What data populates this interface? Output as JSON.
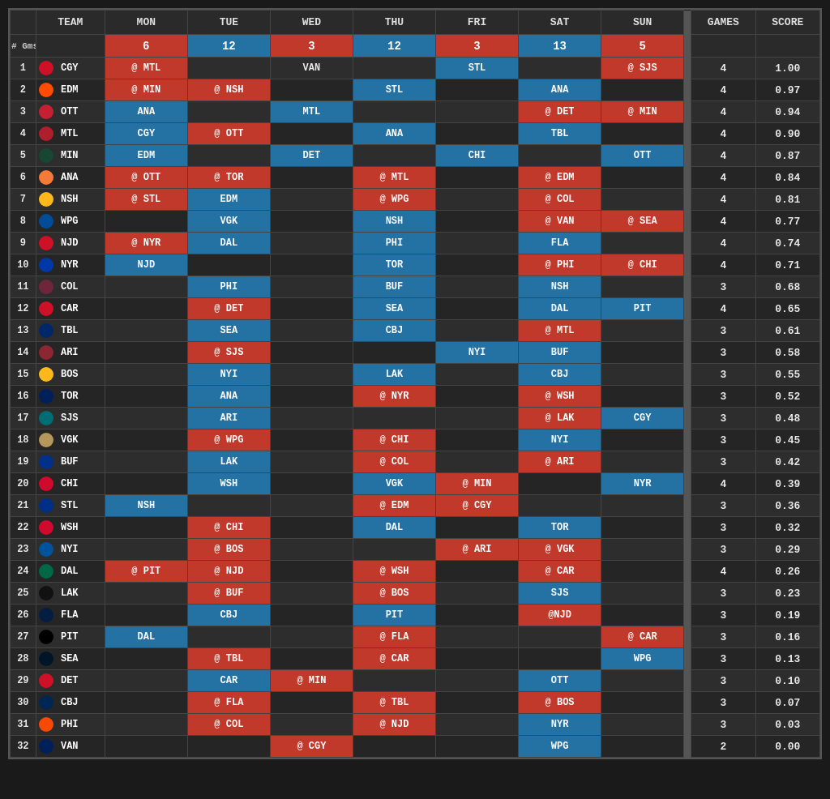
{
  "header": {
    "col1": "#",
    "col2": "TEAM",
    "days": [
      "MON",
      "TUE",
      "WED",
      "THU",
      "FRI",
      "SAT",
      "SUN"
    ],
    "games": "GAMES",
    "score": "SCORE",
    "gms_label": "# Gms",
    "day_counts": [
      "6",
      "12",
      "3",
      "12",
      "3",
      "13",
      "5"
    ]
  },
  "teams": [
    {
      "rank": 1,
      "abbr": "CGY",
      "icon": "CGY",
      "mon": "@ MTL",
      "tue": "",
      "wed": "VAN",
      "thu": "",
      "fri": "STL",
      "sat": "",
      "sun": "@ SJS",
      "games": 4,
      "score": "1.00",
      "mon_c": "red",
      "fri_c": "blue",
      "sun_c": "red"
    },
    {
      "rank": 2,
      "abbr": "EDM",
      "icon": "EDM",
      "mon": "@ MIN",
      "tue": "@ NSH",
      "wed": "",
      "thu": "STL",
      "fri": "",
      "sat": "ANA",
      "sun": "",
      "games": 4,
      "score": "0.97",
      "mon_c": "red",
      "tue_c": "red",
      "thu_c": "blue",
      "sat_c": "blue"
    },
    {
      "rank": 3,
      "abbr": "OTT",
      "icon": "OTT",
      "mon": "ANA",
      "tue": "",
      "wed": "MTL",
      "thu": "",
      "fri": "",
      "sat": "@ DET",
      "sun": "@ MIN",
      "games": 4,
      "score": "0.94",
      "mon_c": "blue",
      "wed_c": "blue",
      "sat_c": "red",
      "sun_c": "red"
    },
    {
      "rank": 4,
      "abbr": "MTL",
      "icon": "MTL",
      "mon": "CGY",
      "tue": "@ OTT",
      "wed": "",
      "thu": "ANA",
      "fri": "",
      "sat": "TBL",
      "sun": "",
      "games": 4,
      "score": "0.90",
      "mon_c": "blue",
      "tue_c": "red",
      "thu_c": "blue",
      "sat_c": "blue"
    },
    {
      "rank": 5,
      "abbr": "MIN",
      "icon": "MIN",
      "mon": "EDM",
      "tue": "",
      "wed": "DET",
      "thu": "",
      "fri": "CHI",
      "sat": "",
      "sun": "OTT",
      "games": 4,
      "score": "0.87",
      "mon_c": "blue",
      "wed_c": "blue",
      "fri_c": "blue",
      "sun_c": "blue"
    },
    {
      "rank": 6,
      "abbr": "ANA",
      "icon": "ANA",
      "mon": "@ OTT",
      "tue": "@ TOR",
      "wed": "",
      "thu": "@ MTL",
      "fri": "",
      "sat": "@ EDM",
      "sun": "",
      "games": 4,
      "score": "0.84",
      "mon_c": "red",
      "tue_c": "red",
      "thu_c": "red",
      "sat_c": "red"
    },
    {
      "rank": 7,
      "abbr": "NSH",
      "icon": "NSH",
      "mon": "@ STL",
      "tue": "EDM",
      "wed": "",
      "thu": "@ WPG",
      "fri": "",
      "sat": "@ COL",
      "sun": "",
      "games": 4,
      "score": "0.81",
      "mon_c": "red",
      "tue_c": "blue",
      "thu_c": "red",
      "sat_c": "red"
    },
    {
      "rank": 8,
      "abbr": "WPG",
      "icon": "WPG",
      "mon": "",
      "tue": "VGK",
      "wed": "",
      "thu": "NSH",
      "fri": "",
      "sat": "@ VAN",
      "sun": "@ SEA",
      "games": 4,
      "score": "0.77",
      "tue_c": "blue",
      "thu_c": "blue",
      "sat_c": "red",
      "sun_c": "red"
    },
    {
      "rank": 9,
      "abbr": "NJD",
      "icon": "NJD",
      "mon": "@ NYR",
      "tue": "DAL",
      "wed": "",
      "thu": "PHI",
      "fri": "",
      "sat": "FLA",
      "sun": "",
      "games": 4,
      "score": "0.74",
      "mon_c": "red",
      "tue_c": "blue",
      "thu_c": "blue",
      "sat_c": "blue"
    },
    {
      "rank": 10,
      "abbr": "NYR",
      "icon": "NYR",
      "mon": "NJD",
      "tue": "",
      "wed": "",
      "thu": "TOR",
      "fri": "",
      "sat": "@ PHI",
      "sun": "@ CHI",
      "games": 4,
      "score": "0.71",
      "mon_c": "blue",
      "thu_c": "blue",
      "sat_c": "red",
      "sun_c": "red"
    },
    {
      "rank": 11,
      "abbr": "COL",
      "icon": "COL",
      "mon": "",
      "tue": "PHI",
      "wed": "",
      "thu": "BUF",
      "fri": "",
      "sat": "NSH",
      "sun": "",
      "games": 3,
      "score": "0.68",
      "tue_c": "blue",
      "thu_c": "blue",
      "sat_c": "blue"
    },
    {
      "rank": 12,
      "abbr": "CAR",
      "icon": "CAR",
      "mon": "",
      "tue": "@ DET",
      "wed": "",
      "thu": "SEA",
      "fri": "",
      "sat": "DAL",
      "sun": "PIT",
      "games": 4,
      "score": "0.65",
      "tue_c": "red",
      "thu_c": "blue",
      "sat_c": "blue",
      "sun_c": "blue"
    },
    {
      "rank": 13,
      "abbr": "TBL",
      "icon": "TBL",
      "mon": "",
      "tue": "SEA",
      "wed": "",
      "thu": "CBJ",
      "fri": "",
      "sat": "@ MTL",
      "sun": "",
      "games": 3,
      "score": "0.61",
      "tue_c": "blue",
      "thu_c": "blue",
      "sat_c": "red"
    },
    {
      "rank": 14,
      "abbr": "ARI",
      "icon": "ARI",
      "mon": "",
      "tue": "@ SJS",
      "wed": "",
      "thu": "",
      "fri": "NYI",
      "sat": "BUF",
      "sun": "",
      "games": 3,
      "score": "0.58",
      "tue_c": "red",
      "fri_c": "blue",
      "sat_c": "blue"
    },
    {
      "rank": 15,
      "abbr": "BOS",
      "icon": "BOS",
      "mon": "",
      "tue": "NYI",
      "wed": "",
      "thu": "LAK",
      "fri": "",
      "sat": "CBJ",
      "sun": "",
      "games": 3,
      "score": "0.55",
      "tue_c": "blue",
      "thu_c": "blue",
      "sat_c": "blue"
    },
    {
      "rank": 16,
      "abbr": "TOR",
      "icon": "TOR",
      "mon": "",
      "tue": "ANA",
      "wed": "",
      "thu": "@ NYR",
      "fri": "",
      "sat": "@ WSH",
      "sun": "",
      "games": 3,
      "score": "0.52",
      "tue_c": "blue",
      "thu_c": "red",
      "sat_c": "red"
    },
    {
      "rank": 17,
      "abbr": "SJS",
      "icon": "SJS",
      "mon": "",
      "tue": "ARI",
      "wed": "",
      "thu": "",
      "fri": "",
      "sat": "@ LAK",
      "sun": "CGY",
      "games": 3,
      "score": "0.48",
      "tue_c": "blue",
      "sat_c": "red",
      "sun_c": "blue"
    },
    {
      "rank": 18,
      "abbr": "VGK",
      "icon": "VGK",
      "mon": "",
      "tue": "@ WPG",
      "wed": "",
      "thu": "@ CHI",
      "fri": "",
      "sat": "NYI",
      "sun": "",
      "games": 3,
      "score": "0.45",
      "tue_c": "red",
      "thu_c": "red",
      "sat_c": "blue"
    },
    {
      "rank": 19,
      "abbr": "BUF",
      "icon": "BUF",
      "mon": "",
      "tue": "LAK",
      "wed": "",
      "thu": "@ COL",
      "fri": "",
      "sat": "@ ARI",
      "sun": "",
      "games": 3,
      "score": "0.42",
      "tue_c": "blue",
      "thu_c": "red",
      "sat_c": "red"
    },
    {
      "rank": 20,
      "abbr": "CHI",
      "icon": "CHI",
      "mon": "",
      "tue": "WSH",
      "wed": "",
      "thu": "VGK",
      "fri": "@ MIN",
      "sat": "",
      "sun": "NYR",
      "games": 4,
      "score": "0.39",
      "tue_c": "blue",
      "thu_c": "blue",
      "fri_c": "red",
      "sun_c": "blue"
    },
    {
      "rank": 21,
      "abbr": "STL",
      "icon": "STL",
      "mon": "NSH",
      "tue": "",
      "wed": "",
      "thu": "@ EDM",
      "fri": "@ CGY",
      "sat": "",
      "sun": "",
      "games": 3,
      "score": "0.36",
      "mon_c": "blue",
      "thu_c": "red",
      "fri_c": "red"
    },
    {
      "rank": 22,
      "abbr": "WSH",
      "icon": "WSH",
      "mon": "",
      "tue": "@ CHI",
      "wed": "",
      "thu": "DAL",
      "fri": "",
      "sat": "TOR",
      "sun": "",
      "games": 3,
      "score": "0.32",
      "tue_c": "red",
      "thu_c": "blue",
      "sat_c": "blue"
    },
    {
      "rank": 23,
      "abbr": "NYI",
      "icon": "NYI",
      "mon": "",
      "tue": "@ BOS",
      "wed": "",
      "thu": "",
      "fri": "@ ARI",
      "sat": "@ VGK",
      "sun": "",
      "games": 3,
      "score": "0.29",
      "tue_c": "red",
      "fri_c": "red",
      "sat_c": "red"
    },
    {
      "rank": 24,
      "abbr": "DAL",
      "icon": "DAL",
      "mon": "@ PIT",
      "tue": "@ NJD",
      "wed": "",
      "thu": "@ WSH",
      "fri": "",
      "sat": "@ CAR",
      "sun": "",
      "games": 4,
      "score": "0.26",
      "mon_c": "red",
      "tue_c": "red",
      "thu_c": "red",
      "sat_c": "red"
    },
    {
      "rank": 25,
      "abbr": "LAK",
      "icon": "LAK",
      "mon": "",
      "tue": "@ BUF",
      "wed": "",
      "thu": "@ BOS",
      "fri": "",
      "sat": "SJS",
      "sun": "",
      "games": 3,
      "score": "0.23",
      "tue_c": "red",
      "thu_c": "red",
      "sat_c": "blue"
    },
    {
      "rank": 26,
      "abbr": "FLA",
      "icon": "FLA",
      "mon": "",
      "tue": "CBJ",
      "wed": "",
      "thu": "PIT",
      "fri": "",
      "sat": "@NJD",
      "sun": "",
      "games": 3,
      "score": "0.19",
      "tue_c": "blue",
      "thu_c": "blue",
      "sat_c": "red"
    },
    {
      "rank": 27,
      "abbr": "PIT",
      "icon": "PIT",
      "mon": "DAL",
      "tue": "",
      "wed": "",
      "thu": "@ FLA",
      "fri": "",
      "sat": "",
      "sun": "@ CAR",
      "games": 3,
      "score": "0.16",
      "mon_c": "blue",
      "thu_c": "red",
      "sun_c": "red"
    },
    {
      "rank": 28,
      "abbr": "SEA",
      "icon": "SEA",
      "mon": "",
      "tue": "@ TBL",
      "wed": "",
      "thu": "@ CAR",
      "fri": "",
      "sat": "",
      "sun": "WPG",
      "games": 3,
      "score": "0.13",
      "tue_c": "red",
      "thu_c": "red",
      "sun_c": "blue"
    },
    {
      "rank": 29,
      "abbr": "DET",
      "icon": "DET",
      "mon": "",
      "tue": "CAR",
      "wed": "@ MIN",
      "thu": "",
      "fri": "",
      "sat": "OTT",
      "sun": "",
      "games": 3,
      "score": "0.10",
      "tue_c": "blue",
      "wed_c": "red",
      "sat_c": "blue"
    },
    {
      "rank": 30,
      "abbr": "CBJ",
      "icon": "CBJ",
      "mon": "",
      "tue": "@ FLA",
      "wed": "",
      "thu": "@ TBL",
      "fri": "",
      "sat": "@ BOS",
      "sun": "",
      "games": 3,
      "score": "0.07",
      "tue_c": "red",
      "thu_c": "red",
      "sat_c": "red"
    },
    {
      "rank": 31,
      "abbr": "PHI",
      "icon": "PHI",
      "mon": "",
      "tue": "@ COL",
      "wed": "",
      "thu": "@ NJD",
      "fri": "",
      "sat": "NYR",
      "sun": "",
      "games": 3,
      "score": "0.03",
      "tue_c": "red",
      "thu_c": "red",
      "sat_c": "blue"
    },
    {
      "rank": 32,
      "abbr": "VAN",
      "icon": "VAN",
      "mon": "",
      "tue": "",
      "wed": "@ CGY",
      "thu": "",
      "fri": "",
      "sat": "WPG",
      "sun": "",
      "games": 2,
      "score": "0.00",
      "wed_c": "red",
      "sat_c": "blue"
    }
  ]
}
